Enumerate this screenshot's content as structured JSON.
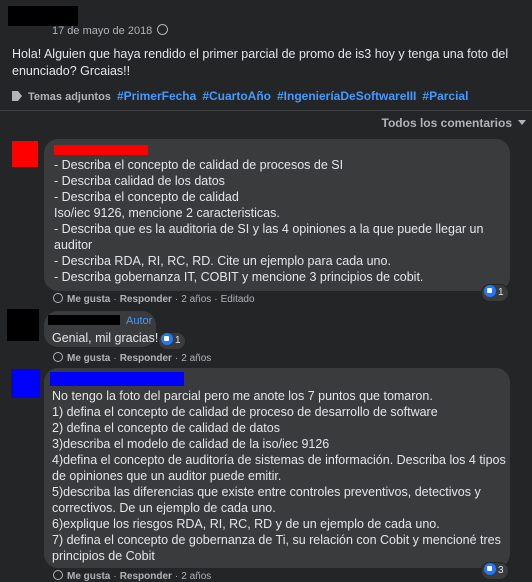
{
  "post": {
    "date": "17 de mayo de 2018",
    "privacy_icon": "globe-icon",
    "text_line1": "Hola! Alguien que haya rendido el primer parcial de promo de is3 hoy y tenga una foto del",
    "text_line2": "enunciado? Grcaias!!",
    "topics_label": "Temas adjuntos",
    "hashtags": [
      "#PrimerFecha",
      "#CuartoAño",
      "#IngenieríaDeSoftwareIII",
      "#Parcial"
    ]
  },
  "comments_sort": "Todos los comentarios",
  "comment1": {
    "lines": [
      "- Describa el concepto de calidad de procesos de SI",
      "- Describa calidad de los datos",
      "- Describa el concepto de calidad",
      "Iso/iec 9126, mencione 2 caracteristicas.",
      "- Describa que es la auditoria de SI y las 4 opiniones a la que puede llegar un",
      "auditor",
      "- Describa RDA, RI, RC, RD. Cite un ejemplo para cada uno.",
      "- Describa gobernanza IT, COBIT y mencione 3 principios de cobit."
    ],
    "reactions": "1",
    "like": "Me gusta",
    "reply": "Responder",
    "time": "2 años",
    "edited": "Editado"
  },
  "comment2": {
    "author_badge": "Autor",
    "text": "Genial, mil gracias!",
    "reactions": "1",
    "like": "Me gusta",
    "reply": "Responder",
    "time": "2 años"
  },
  "comment3": {
    "lines": [
      "No tengo la foto del parcial pero me anote los 7 puntos que tomaron.",
      "1) defina el concepto de calidad de proceso de desarrollo de software",
      "2) defina el concepto de calidad de datos",
      "3)describa el modelo de calidad de la iso/iec 9126",
      "4)defina el concepto de auditoría de sistemas de información. Describa los 4 tipos",
      "de opiniones que un auditor puede emitir.",
      "5)describa las diferencias que existe entre controles preventivos, detectivos y",
      "correctivos. De un ejemplo de cada uno.",
      "6)explique los riesgos RDA, RI, RC, RD y de un ejemplo de cada uno.",
      "7) defina el concepto de gobernanza de Ti, su relación con Cobit y mencioné tres",
      "principios de Cobit"
    ],
    "reactions": "3",
    "like": "Me gusta",
    "reply": "Responder",
    "time": "2 años"
  },
  "colors": {
    "background": "#242526",
    "bubble": "#3a3b3c",
    "link": "#4599ff",
    "avatar1": "#ff0000",
    "avatar3": "#0000ff"
  }
}
